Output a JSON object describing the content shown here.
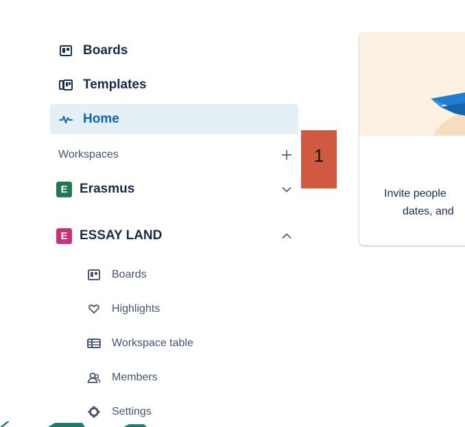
{
  "nav": {
    "boards": "Boards",
    "templates": "Templates",
    "home": "Home"
  },
  "workspaces": {
    "header": "Workspaces",
    "add_icon": "plus-icon",
    "items": [
      {
        "initial": "E",
        "name": "Erasmus",
        "color": "#1f7a4d",
        "expanded": false
      },
      {
        "initial": "E",
        "name": "ESSAY LAND",
        "color": "#c7327a",
        "expanded": true
      }
    ]
  },
  "essay_land_menu": {
    "boards": "Boards",
    "highlights": "Highlights",
    "workspace_table": "Workspace table",
    "members": "Members",
    "settings": "Settings"
  },
  "marker": {
    "label": "1"
  },
  "card": {
    "line1": "Invite people",
    "line2": "dates, and"
  },
  "colors": {
    "active_bg": "#e4f0f6",
    "active_text": "#0c66b7",
    "marker": "#cf5a3f",
    "card_header": "#fdf1e3",
    "plane": "#1e7fd0"
  }
}
